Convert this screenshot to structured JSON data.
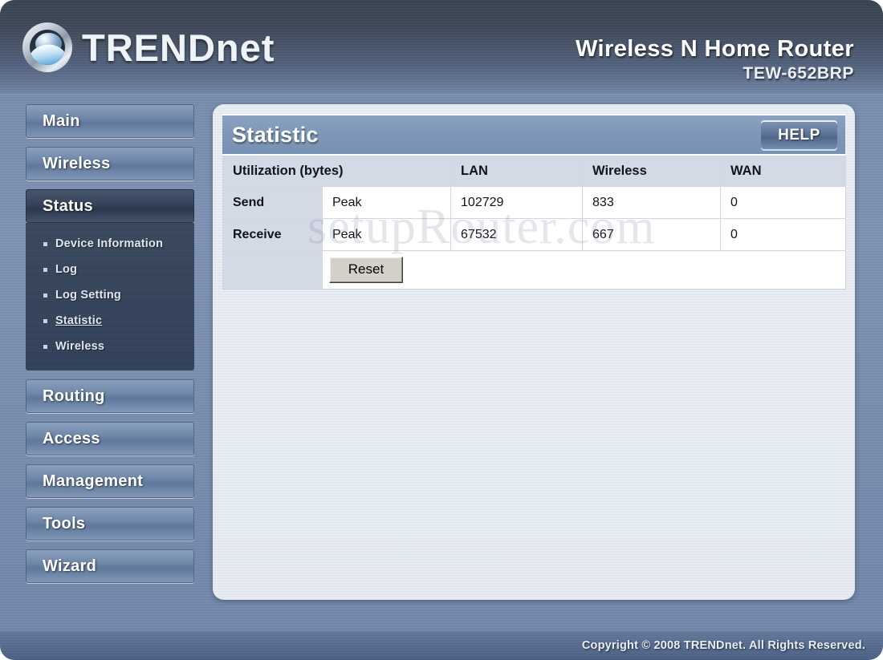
{
  "banner": {
    "brand_upper": "TREND",
    "brand_lower": "net",
    "logo_icon": "trendnet-wave-logo-icon",
    "product_name": "Wireless N Home Router",
    "model_number": "TEW-652BRP"
  },
  "sidebar": {
    "items": [
      {
        "label": "Main",
        "active": false
      },
      {
        "label": "Wireless",
        "active": false
      },
      {
        "label": "Status",
        "active": true
      },
      {
        "label": "Routing",
        "active": false
      },
      {
        "label": "Access",
        "active": false
      },
      {
        "label": "Management",
        "active": false
      },
      {
        "label": "Tools",
        "active": false
      },
      {
        "label": "Wizard",
        "active": false
      }
    ],
    "submenu": [
      {
        "label": "Device Information",
        "current": false
      },
      {
        "label": "Log",
        "current": false
      },
      {
        "label": "Log Setting",
        "current": false
      },
      {
        "label": "Statistic",
        "current": true
      },
      {
        "label": "Wireless",
        "current": false
      }
    ]
  },
  "panel": {
    "title": "Statistic",
    "help_label": "HELP",
    "table": {
      "headers": [
        "Utilization (bytes)",
        "",
        "LAN",
        "Wireless",
        "WAN"
      ],
      "rows": [
        {
          "label": "Send",
          "metric": "Peak",
          "lan": "102729",
          "wireless": "833",
          "wan": "0"
        },
        {
          "label": "Receive",
          "metric": "Peak",
          "lan": "67532",
          "wireless": "667",
          "wan": "0"
        }
      ],
      "reset_label": "Reset"
    }
  },
  "watermark": "setupRouter.com",
  "footer": {
    "copyright": "Copyright © 2008 TRENDnet. All Rights Reserved."
  }
}
